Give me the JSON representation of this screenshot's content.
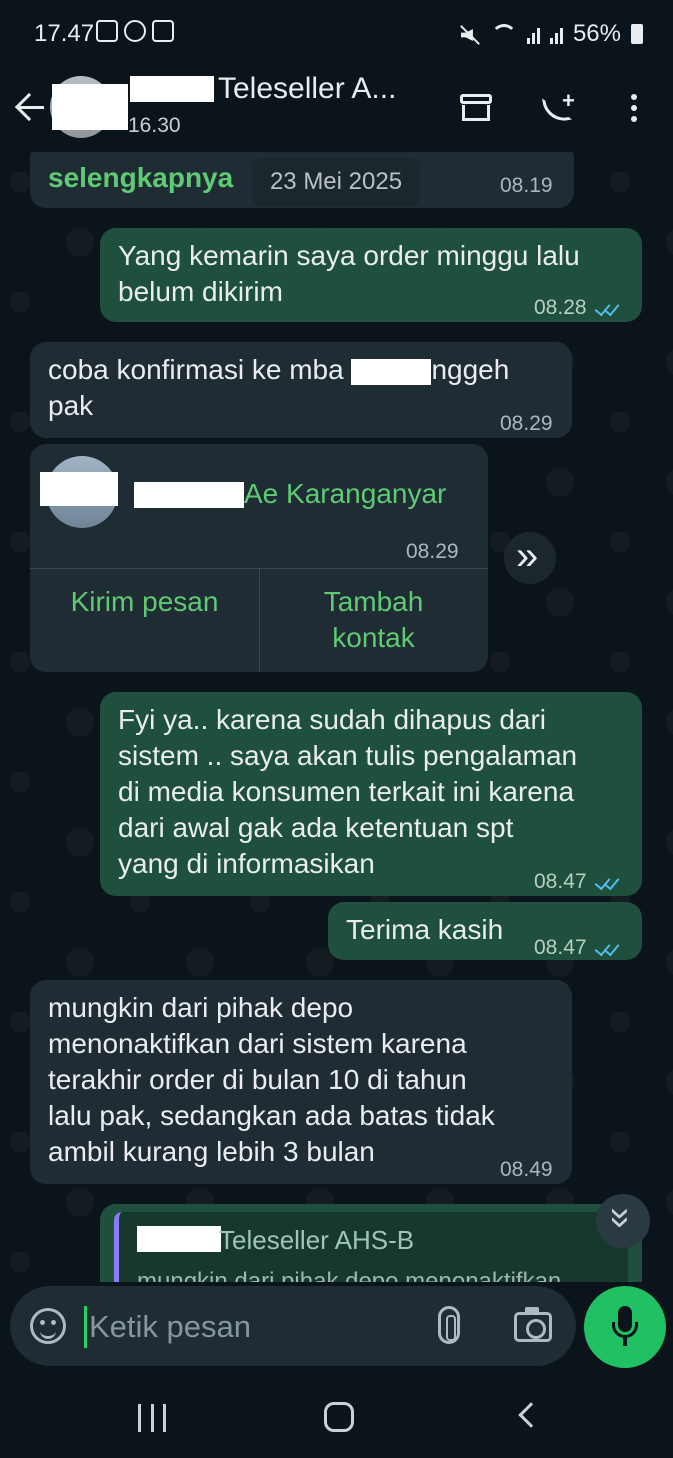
{
  "status_bar": {
    "time": "17.47",
    "battery": "56%"
  },
  "header": {
    "contact_name": "Teleseller A...",
    "last_seen": "16.30",
    "icons": [
      "back-arrow",
      "avatar",
      "store-icon",
      "call-add-icon",
      "more-vert-icon"
    ]
  },
  "messages": [
    {
      "direction": "in",
      "read_more": "selengkapnya",
      "date_chip": "23 Mei 2025",
      "time": "08.19"
    },
    {
      "direction": "out",
      "text": "Yang kemarin saya order minggu lalu\nbelum dikirim",
      "time": "08.28",
      "status": "read"
    },
    {
      "direction": "in",
      "text_before": "coba konfirmasi ke mba ",
      "text_after": "nggeh\npak",
      "time": "08.29"
    },
    {
      "direction": "in",
      "type": "contact_card",
      "contact_name_suffix": "Ae Karanganyar",
      "time": "08.29",
      "btn_message": "Kirim pesan",
      "btn_add": "Tambah\nkontak"
    },
    {
      "direction": "out",
      "text": "Fyi ya.. karena sudah dihapus dari\nsistem .. saya akan tulis pengalaman\ndi media konsumen terkait ini karena\ndari awal gak ada ketentuan spt\nyang di informasikan",
      "time": "08.47",
      "status": "read"
    },
    {
      "direction": "out",
      "text": "Terima kasih",
      "time": "08.47",
      "status": "read"
    },
    {
      "direction": "in",
      "text": "mungkin dari pihak depo\nmenonaktifkan dari sistem karena\nterakhir order di bulan 10 di tahun\nlalu pak, sedangkan ada batas tidak\nambil kurang lebih 3 bulan",
      "time": "08.49"
    },
    {
      "direction": "out",
      "type": "reply",
      "quote_name": "Teleseller AHS-B",
      "quote_text": "mungkin dari pihak depo menonaktifkan"
    }
  ],
  "input": {
    "placeholder": "Ketik pesan",
    "value": ""
  },
  "colors": {
    "background": "#0b141a",
    "incoming_bubble": "#202c33",
    "outgoing_bubble": "#1f4f3d",
    "accent_green": "#21c063",
    "read_ticks": "#53bdeb"
  }
}
